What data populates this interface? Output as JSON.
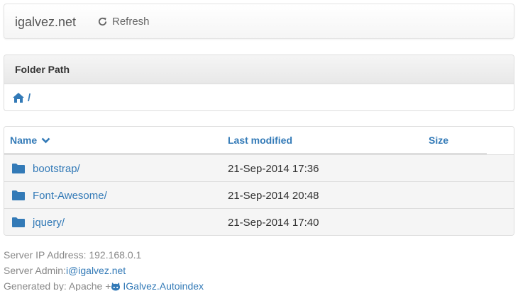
{
  "navbar": {
    "brand": "igalvez.net",
    "refresh_label": "Refresh",
    "refresh_icon": "refresh-icon"
  },
  "folder_path": {
    "heading": "Folder Path",
    "home_icon": "home-icon",
    "separator": "/"
  },
  "table": {
    "columns": {
      "name": "Name",
      "last_modified": "Last modified",
      "size": "Size"
    },
    "sort_icon": "chevron-down-icon",
    "rows": [
      {
        "name": "bootstrap/",
        "modified": "21-Sep-2014 17:36",
        "size": "",
        "icon": "folder-icon"
      },
      {
        "name": "Font-Awesome/",
        "modified": "21-Sep-2014 20:48",
        "size": "",
        "icon": "folder-icon"
      },
      {
        "name": "jquery/",
        "modified": "21-Sep-2014 17:40",
        "size": "",
        "icon": "folder-icon"
      }
    ]
  },
  "footer": {
    "server_ip_label": "Server IP Address: 192.168.0.1",
    "server_admin_label": "Server Admin: ",
    "server_admin_email": "i@igalvez.net",
    "generated_label": "Generated by: Apache + ",
    "generator_link": "IGalvez.Autoindex",
    "generator_icon": "github-icon"
  },
  "colors": {
    "link": "#337ab7",
    "row_background": "#f5f5f5",
    "muted_text": "#888888"
  }
}
